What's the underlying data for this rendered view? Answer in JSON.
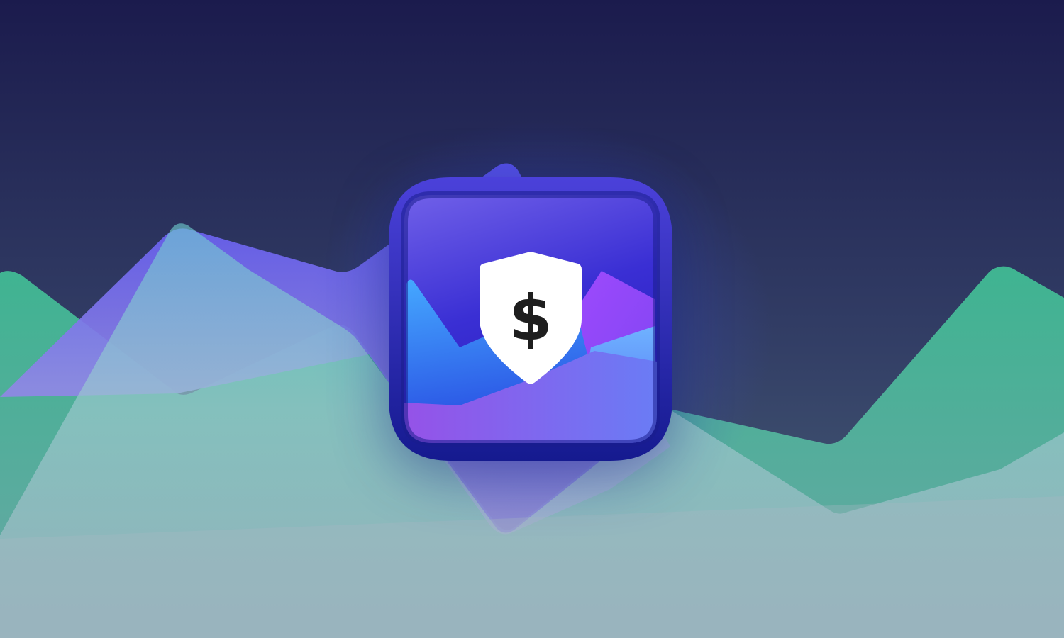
{
  "scene": {
    "theme": "finance-app-promo",
    "colors": {
      "sky_top": "#1b1b4d",
      "sky_bottom": "#3f5673",
      "green_ridge": "#45b596",
      "purple_ridge": "#6b5df2",
      "fog": "#c8d4dc",
      "icon_frame": "#1b1f9c",
      "icon_face_top": "#5448e0",
      "icon_face_bottom": "#2a1fc5",
      "shield": "#ffffff",
      "dollar": "#1e1e1e"
    }
  },
  "app_icon": {
    "name": "shield-dollar-app-icon",
    "badge_icon": "shield-icon",
    "glyph": "$"
  }
}
